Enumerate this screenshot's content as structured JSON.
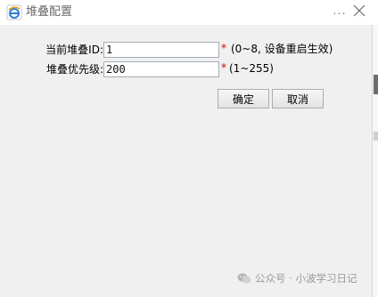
{
  "window": {
    "title": "堆叠配置",
    "more_label": "...",
    "icon": "ie-browser-icon"
  },
  "form": {
    "stack_id": {
      "label": "当前堆叠ID:",
      "value": "1",
      "required_mark": "*",
      "hint": "(0~8, 设备重启生效)"
    },
    "stack_priority": {
      "label": "堆叠优先级:",
      "value": "200",
      "required_mark": "*",
      "hint": "(1~255)"
    }
  },
  "actions": {
    "ok_label": "确定",
    "cancel_label": "取消"
  },
  "watermark": {
    "text": "公众号 · 小波学习日记",
    "icon": "wechat-icon"
  },
  "colors": {
    "required": "#d40000",
    "background": "#f0f0f0"
  }
}
